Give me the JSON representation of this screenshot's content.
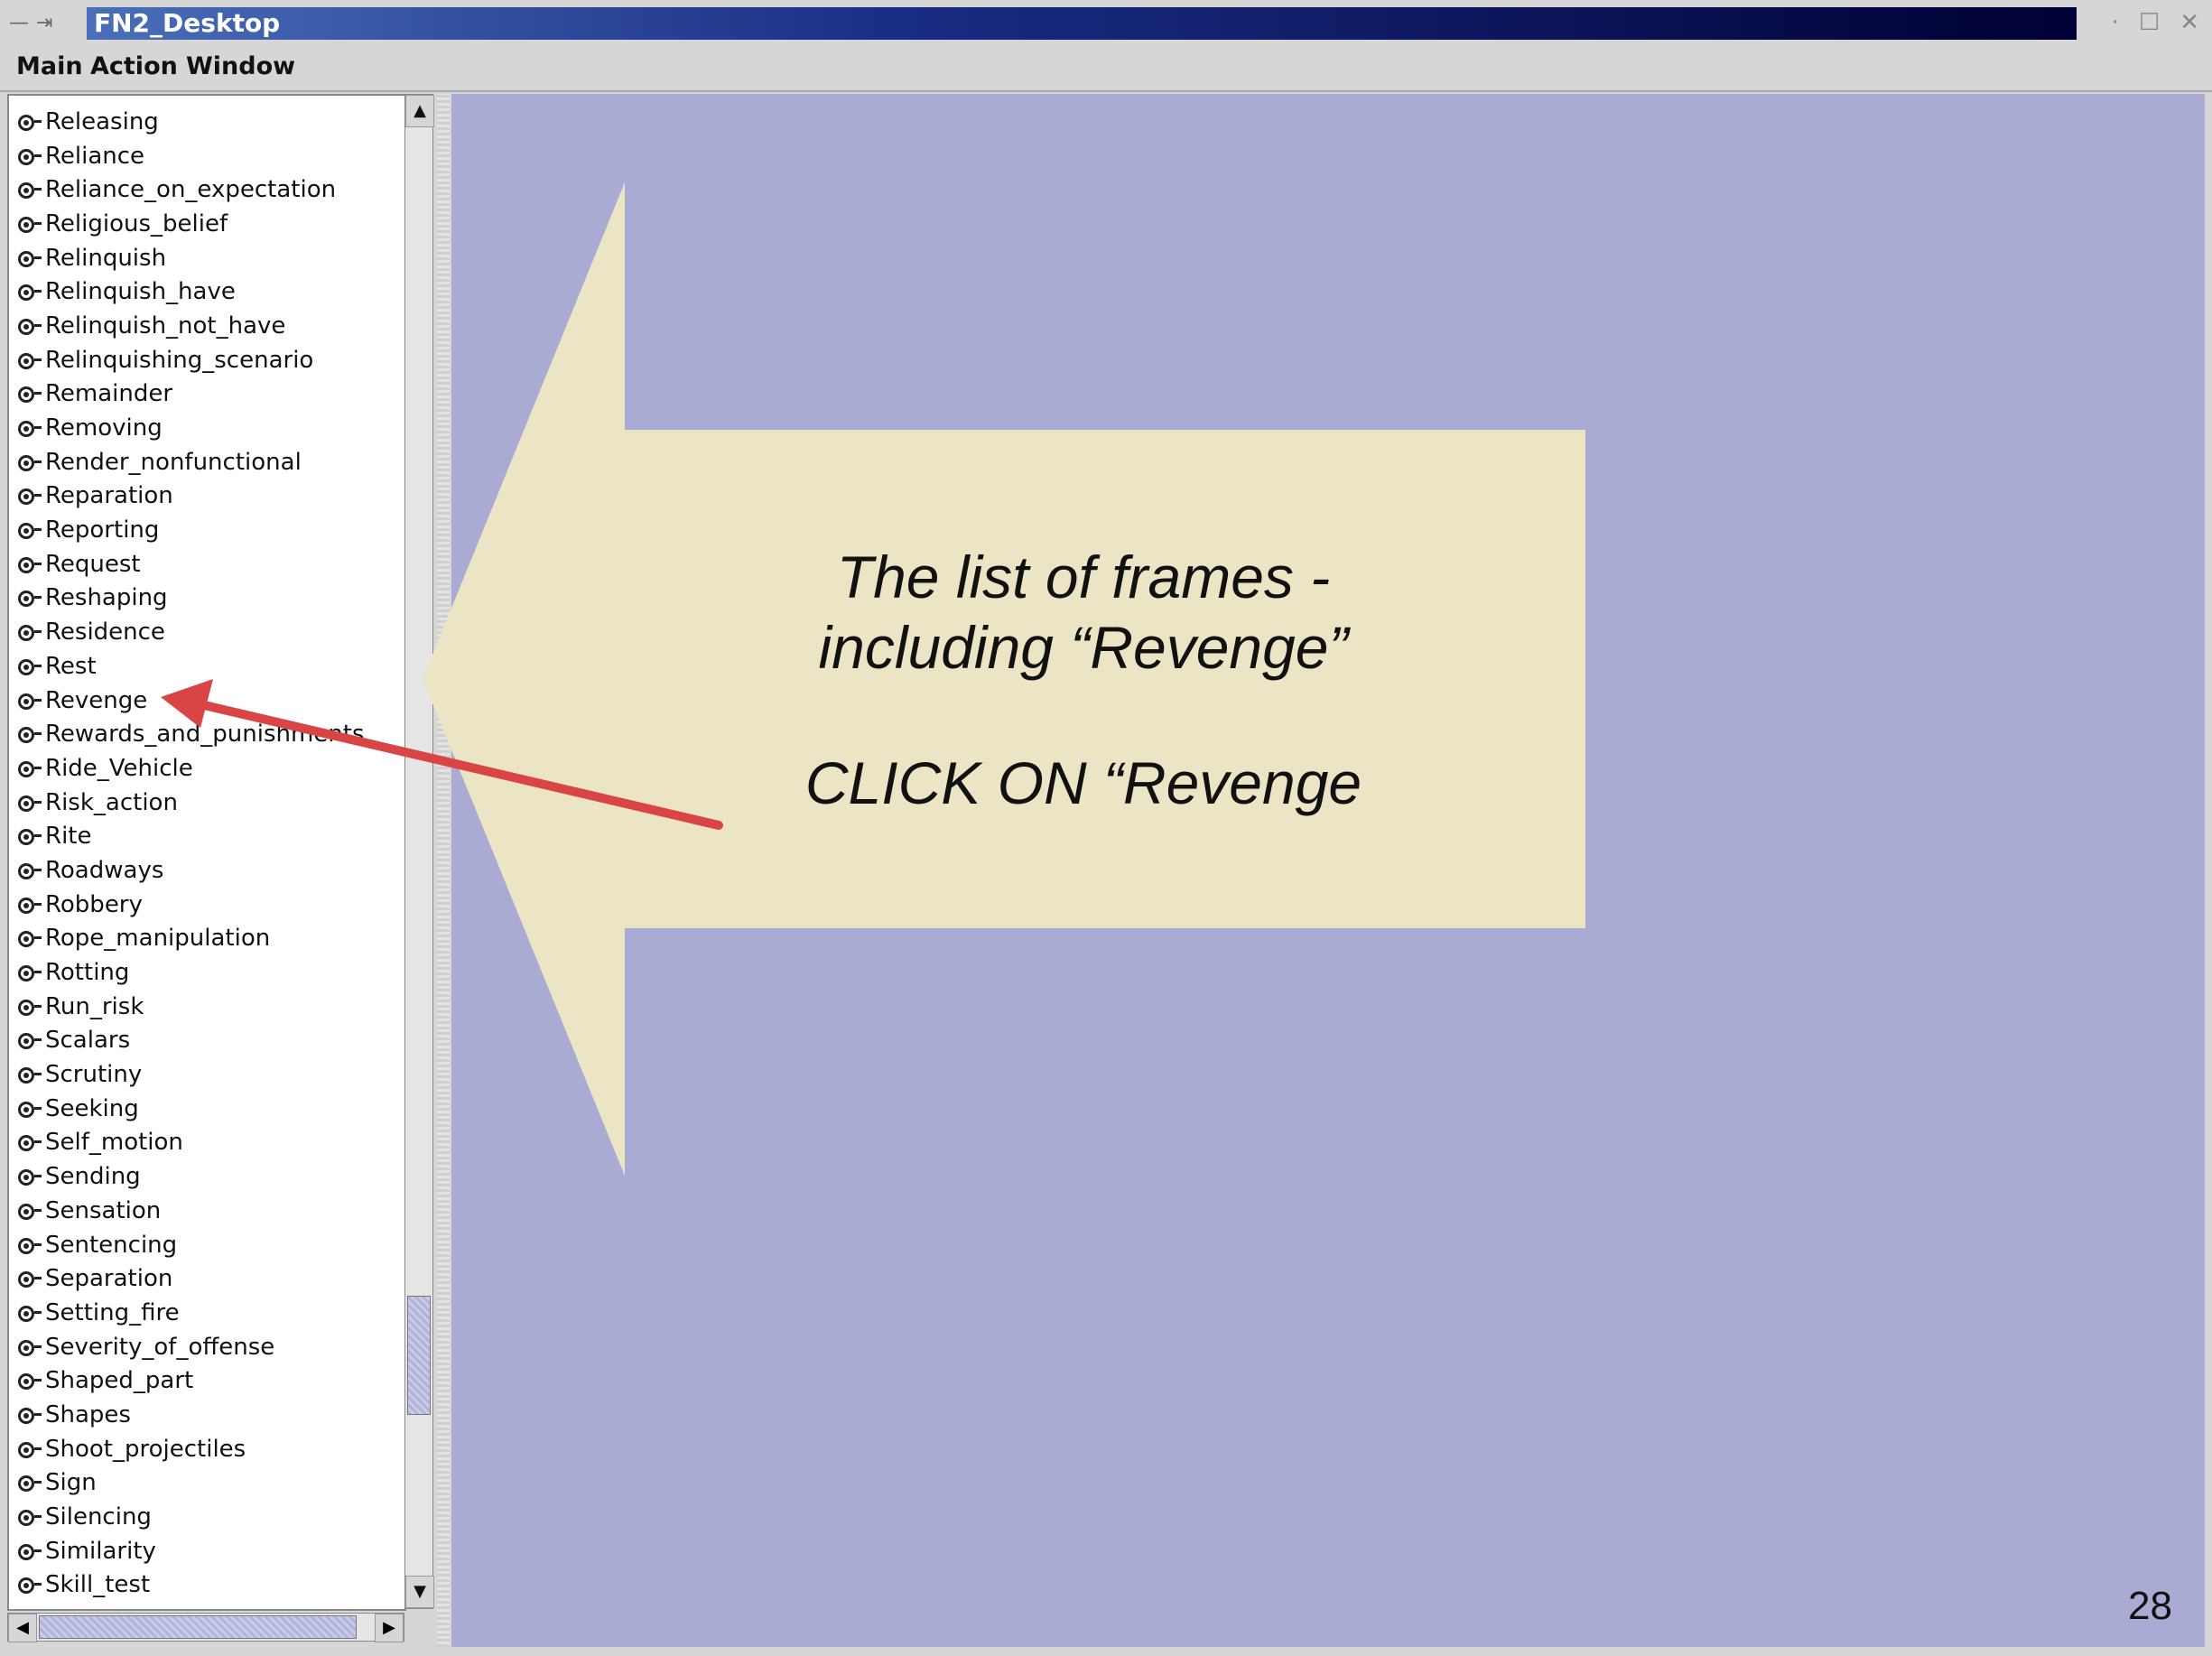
{
  "window": {
    "title": "FN2_Desktop",
    "controls": [
      "minimize",
      "maximize",
      "close"
    ]
  },
  "menubar": {
    "items": [
      "Main",
      "Action",
      "Window"
    ]
  },
  "frame_list": {
    "items": [
      "Releasing",
      "Reliance",
      "Reliance_on_expectation",
      "Religious_belief",
      "Relinquish",
      "Relinquish_have",
      "Relinquish_not_have",
      "Relinquishing_scenario",
      "Remainder",
      "Removing",
      "Render_nonfunctional",
      "Reparation",
      "Reporting",
      "Request",
      "Reshaping",
      "Residence",
      "Rest",
      "Revenge",
      "Rewards_and_punishments",
      "Ride_Vehicle",
      "Risk_action",
      "Rite",
      "Roadways",
      "Robbery",
      "Rope_manipulation",
      "Rotting",
      "Run_risk",
      "Scalars",
      "Scrutiny",
      "Seeking",
      "Self_motion",
      "Sending",
      "Sensation",
      "Sentencing",
      "Separation",
      "Setting_fire",
      "Severity_of_offense",
      "Shaped_part",
      "Shapes",
      "Shoot_projectiles",
      "Sign",
      "Silencing",
      "Similarity",
      "Skill_test"
    ]
  },
  "callout": {
    "line1": "The list of frames -",
    "line2": "including “Revenge”",
    "line3": "CLICK ON “Revenge",
    "fill_color": "#ece5c5",
    "arrow_color": "#d94545"
  },
  "slide_number": "28",
  "colors": {
    "desktop_bg": "#a9abd3",
    "titlebar_gradient_end": "#000034"
  }
}
